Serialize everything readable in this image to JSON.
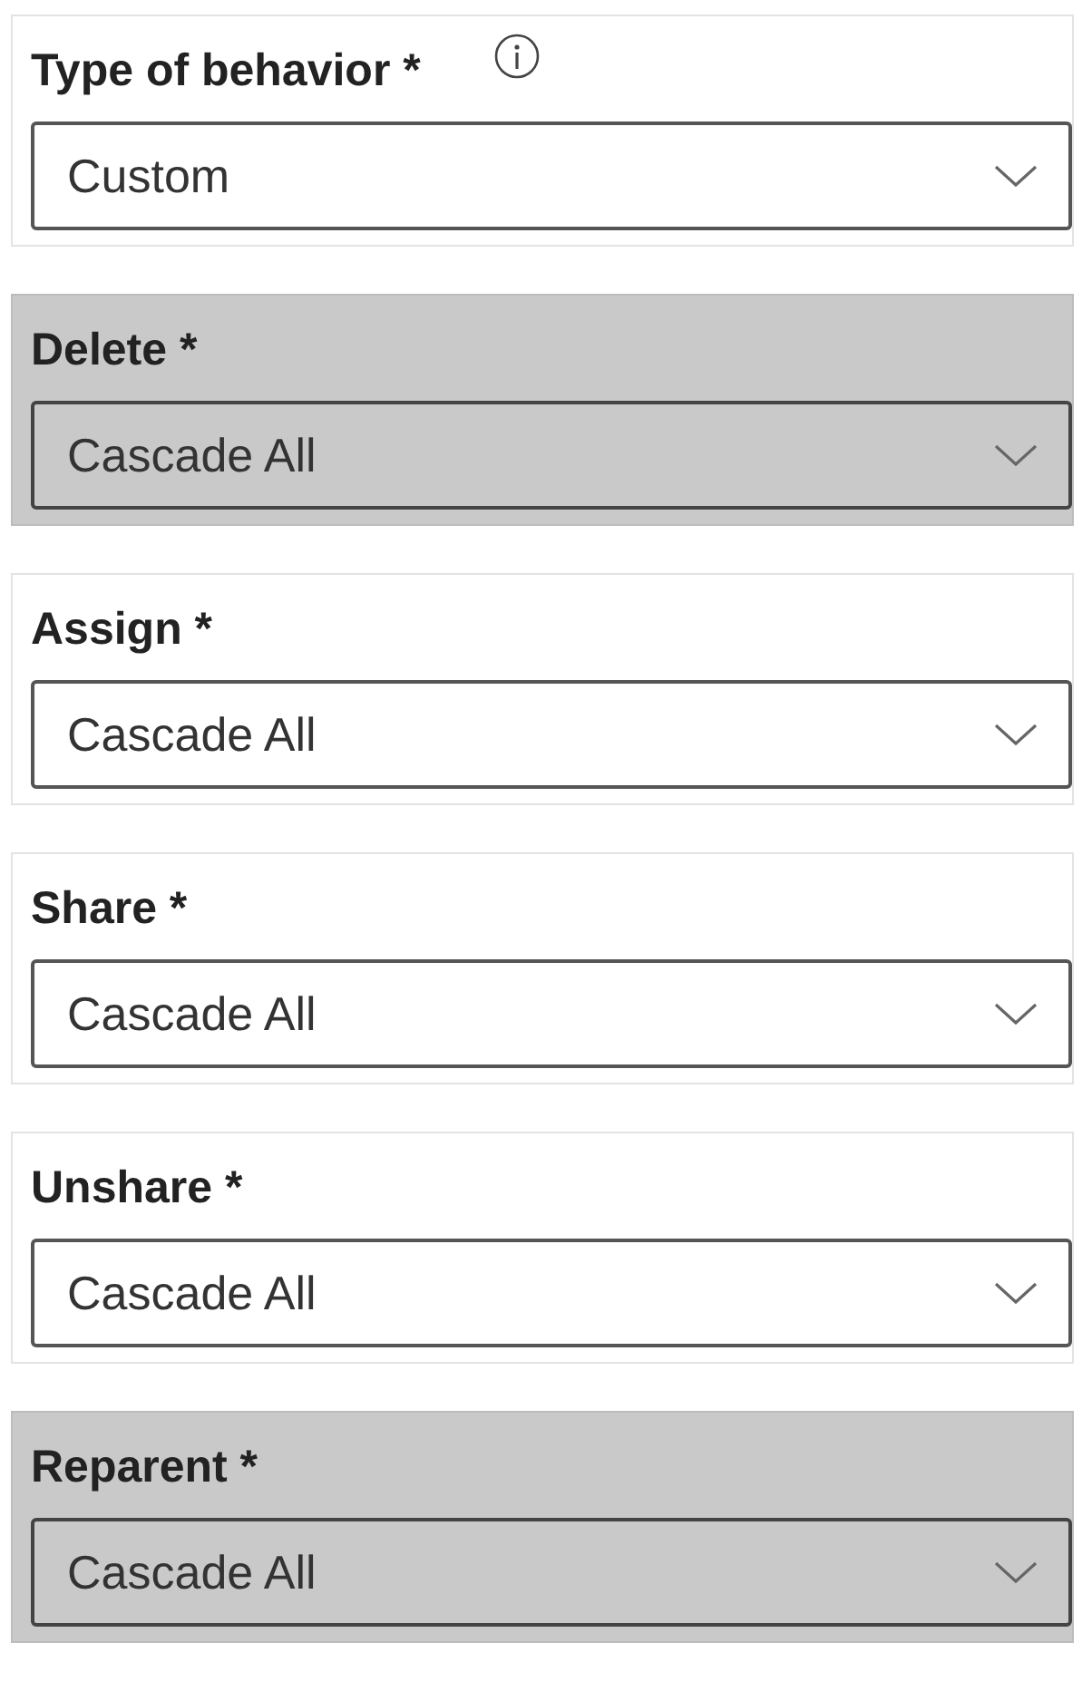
{
  "fields": [
    {
      "label": "Type of behavior *",
      "info": true,
      "highlighted": false,
      "value": "Custom"
    },
    {
      "label": "Delete *",
      "info": false,
      "highlighted": true,
      "value": "Cascade All"
    },
    {
      "label": "Assign *",
      "info": false,
      "highlighted": false,
      "value": "Cascade All"
    },
    {
      "label": "Share *",
      "info": false,
      "highlighted": false,
      "value": "Cascade All"
    },
    {
      "label": "Unshare *",
      "info": false,
      "highlighted": false,
      "value": "Cascade All"
    },
    {
      "label": "Reparent *",
      "info": false,
      "highlighted": true,
      "value": "Cascade All"
    }
  ]
}
